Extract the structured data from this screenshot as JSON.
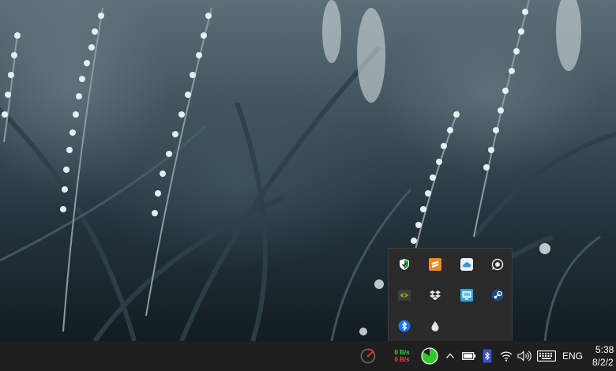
{
  "taskbar": {
    "network_meter": {
      "upload": "0 B/s",
      "download": "0 B/s"
    },
    "language": "ENG",
    "clock": {
      "time": "5:38 /",
      "date": "8/2/2"
    },
    "icons": [
      "cpu-meter-icon",
      "memory-pie-icon",
      "chevron-up-icon",
      "battery-icon",
      "bluetooth-device-icon",
      "wifi-icon",
      "speaker-icon",
      "keyboard-icon"
    ]
  },
  "tray_overflow": {
    "icons": [
      "windows-security-icon",
      "sublime-text-icon",
      "icloud-icon",
      "headset-icon",
      "nvidia-icon",
      "dropbox-icon",
      "monitor-app-icon",
      "steam-icon",
      "bluetooth-icon",
      "droplet-icon"
    ]
  },
  "colors": {
    "taskbar_bg": "#1f1f1f",
    "flyout_bg": "#2b2b2b",
    "upload_green": "#37d43e",
    "download_red": "#ff3a3a"
  }
}
